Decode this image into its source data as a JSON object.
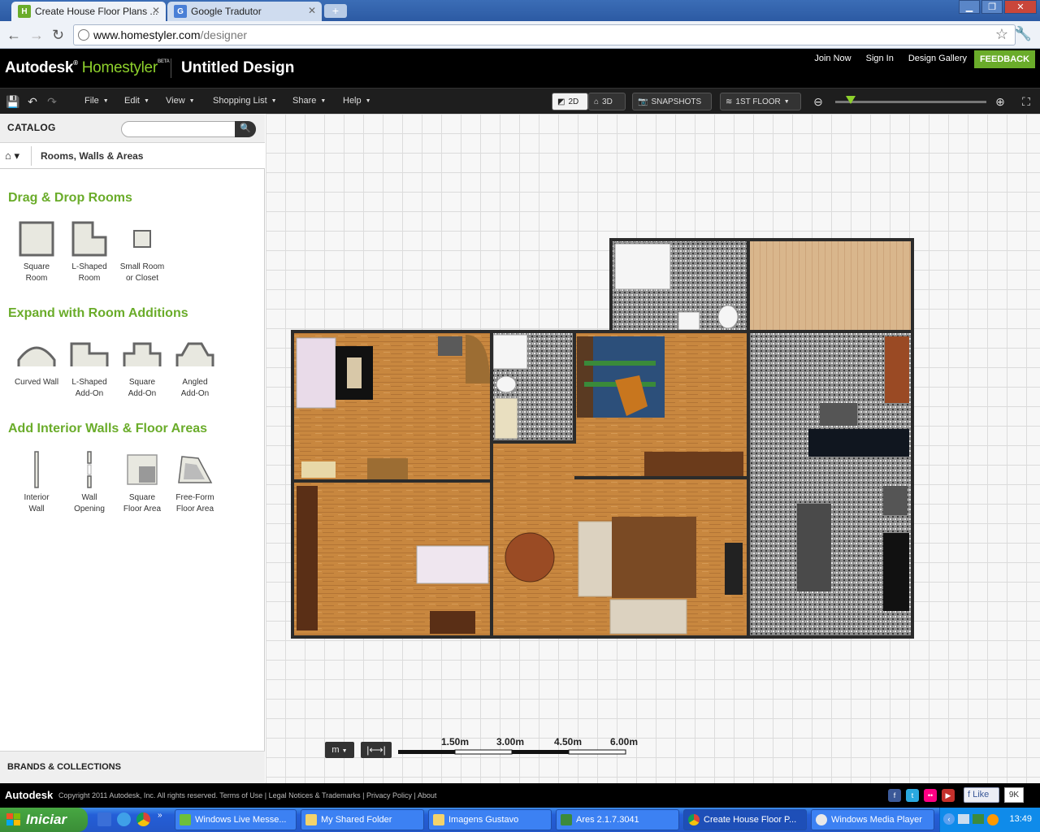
{
  "browser": {
    "tabs": [
      {
        "title": "Create House Floor Plans ...",
        "active": true
      },
      {
        "title": "Google Tradutor",
        "active": false
      }
    ],
    "url_host": "www.homestyler.com",
    "url_path": "/designer"
  },
  "app": {
    "brand_autodesk": "Autodesk",
    "brand_homestyler": "Homestyler",
    "brand_beta": "BETA",
    "design_title": "Untitled Design",
    "toplinks": [
      "Join Now",
      "Sign In",
      "Design Gallery"
    ],
    "feedback": "FEEDBACK"
  },
  "toolbar": {
    "menus": [
      "File",
      "Edit",
      "View",
      "Shopping List",
      "Share",
      "Help"
    ],
    "view_2d": "2D",
    "view_3d": "3D",
    "snapshots": "SNAPSHOTS",
    "floor": "1ST FLOOR",
    "zoom_level": 0.1
  },
  "catalog": {
    "title": "CATALOG",
    "search_placeholder": "",
    "breadcrumb": "Rooms, Walls & Areas",
    "sections": [
      {
        "title": "Drag & Drop Rooms",
        "items": [
          {
            "line1": "Square",
            "line2": "Room",
            "icon": "square-room-icon"
          },
          {
            "line1": "L-Shaped",
            "line2": "Room",
            "icon": "l-shaped-room-icon"
          },
          {
            "line1": "Small Room",
            "line2": "or Closet",
            "icon": "small-room-icon"
          }
        ]
      },
      {
        "title": "Expand with Room Additions",
        "items": [
          {
            "line1": "Curved Wall",
            "line2": "",
            "icon": "curved-wall-icon"
          },
          {
            "line1": "L-Shaped",
            "line2": "Add-On",
            "icon": "l-shaped-addon-icon"
          },
          {
            "line1": "Square",
            "line2": "Add-On",
            "icon": "square-addon-icon"
          },
          {
            "line1": "Angled",
            "line2": "Add-On",
            "icon": "angled-addon-icon"
          }
        ]
      },
      {
        "title": "Add Interior Walls & Floor Areas",
        "items": [
          {
            "line1": "Interior",
            "line2": "Wall",
            "icon": "interior-wall-icon"
          },
          {
            "line1": "Wall",
            "line2": "Opening",
            "icon": "wall-opening-icon"
          },
          {
            "line1": "Square",
            "line2": "Floor Area",
            "icon": "square-floor-area-icon"
          },
          {
            "line1": "Free-Form",
            "line2": "Floor Area",
            "icon": "freeform-floor-area-icon"
          }
        ]
      }
    ],
    "brands": "BRANDS & COLLECTIONS"
  },
  "canvas": {
    "unit": "m",
    "measure_icon": "|⟷|",
    "scale_labels": [
      "1.50m",
      "3.00m",
      "4.50m",
      "6.00m"
    ]
  },
  "footer": {
    "autodesk": "Autodesk",
    "copyright": "Copyright 2011 Autodesk, Inc. All rights reserved. Terms of Use | Legal Notices & Trademarks | Privacy Policy | About",
    "like": "Like",
    "like_count": "9K"
  },
  "taskbar": {
    "start": "Iniciar",
    "buttons": [
      {
        "label": "Windows Live Messe...",
        "active": false
      },
      {
        "label": "My Shared Folder",
        "active": false
      },
      {
        "label": "Imagens Gustavo",
        "active": false
      },
      {
        "label": "Ares 2.1.7.3041",
        "active": false
      },
      {
        "label": "Create House Floor P...",
        "active": true
      },
      {
        "label": "Windows Media Player",
        "active": false
      }
    ],
    "clock": "13:49"
  },
  "colors": {
    "brand_green": "#8ed12c",
    "feedback_green": "#6aac2a",
    "wood_floor": "#c8873f",
    "tile_floor": "#8a8a8a",
    "terrace_floor": "#d8b48a",
    "wall": "#2b2b2b"
  }
}
